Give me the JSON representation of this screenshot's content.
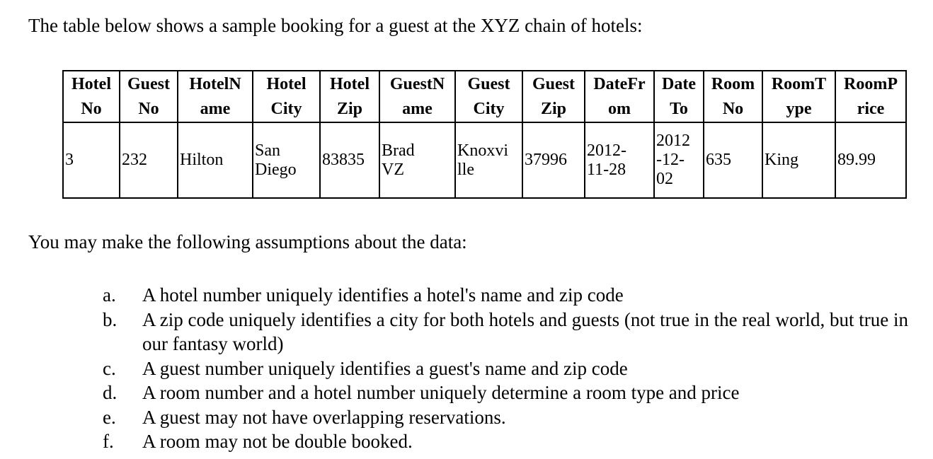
{
  "intro_text": "The table below shows a sample booking for a guest at the XYZ chain of hotels:",
  "table": {
    "headers": [
      "Hotel No",
      "Guest No",
      "HotelName",
      "Hotel City",
      "Hotel Zip",
      "GuestName",
      "Guest City",
      "Guest Zip",
      "DateFrom",
      "Date To",
      "Room No",
      "RoomType",
      "RoomPrice"
    ],
    "header_display": [
      "Hotel\nNo",
      "Guest\nNo",
      "HotelN\name",
      "Hotel\nCity",
      "Hotel\nZip",
      "GuestN\name",
      "Guest\nCity",
      "Guest\nZip",
      "DateFr\nom",
      "Date\nTo",
      "Room\nNo",
      "RoomT\nype",
      "RoomP\nrice"
    ],
    "rows": [
      [
        "3",
        "232",
        "Hilton",
        "San\nDiego",
        "83835",
        "Brad\nVZ",
        "Knoxvi\nlle",
        "37996",
        "2012-\n11-28",
        "2012\n-12-\n02",
        "635",
        "King",
        "89.99"
      ]
    ]
  },
  "assumptions_heading": "You may make the following assumptions about the data:",
  "assumptions": [
    {
      "marker": "a.",
      "text": "A hotel number uniquely identifies a hotel's name and zip code"
    },
    {
      "marker": "b.",
      "text": "A zip code uniquely identifies a city for both hotels and guests (not true in the real world, but true in our fantasy world)"
    },
    {
      "marker": "c.",
      "text": "A guest number uniquely identifies a guest's name and zip code"
    },
    {
      "marker": "d.",
      "text": "A room number and a hotel number uniquely determine a room type and price"
    },
    {
      "marker": "e.",
      "text": "A guest may not have overlapping reservations."
    },
    {
      "marker": "f.",
      "text": "A room may not be double booked."
    }
  ]
}
